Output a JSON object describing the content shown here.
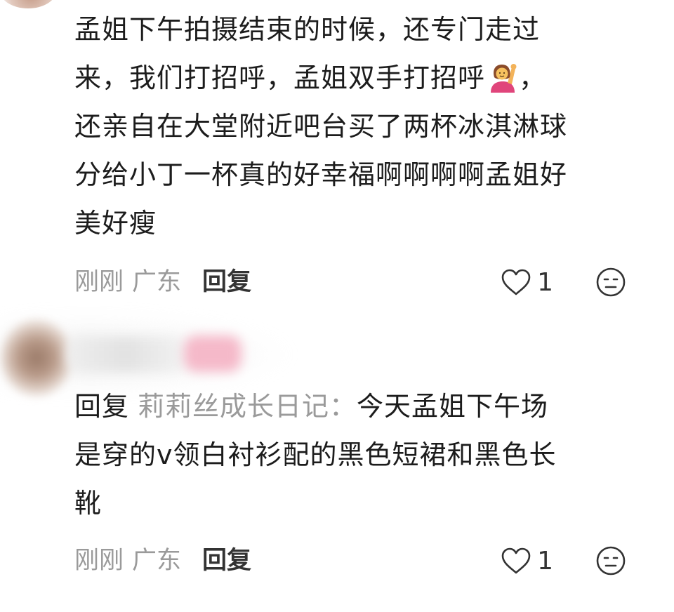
{
  "comments": [
    {
      "lines": [
        "孟姐下午拍摄结束的时候，还专门走过",
        "来，我们打招呼，孟姐双手打招呼",
        "还亲自在大堂附近吧台买了两杯冰淇淋球",
        "分给小丁一杯真的好幸福啊啊啊啊孟姐好",
        "美好瘦"
      ],
      "emoji": "🙋‍♀️",
      "after_emoji": "，",
      "time": "刚刚",
      "location": "广东",
      "reply_label": "回复",
      "likes": "1"
    },
    {
      "reply_prefix": "回复",
      "reply_to": "莉莉丝成长日记：",
      "lines": [
        "今天孟姐下午场",
        "是穿的v领白衬衫配的黑色短裙和黑色长",
        "靴"
      ],
      "time": "刚刚",
      "location": "广东",
      "reply_label": "回复",
      "likes": "1"
    }
  ],
  "colors": {
    "text": "#1c1c1c",
    "meta": "#9a9a9a",
    "reply": "#333333",
    "badge": "#f5b9c9"
  }
}
